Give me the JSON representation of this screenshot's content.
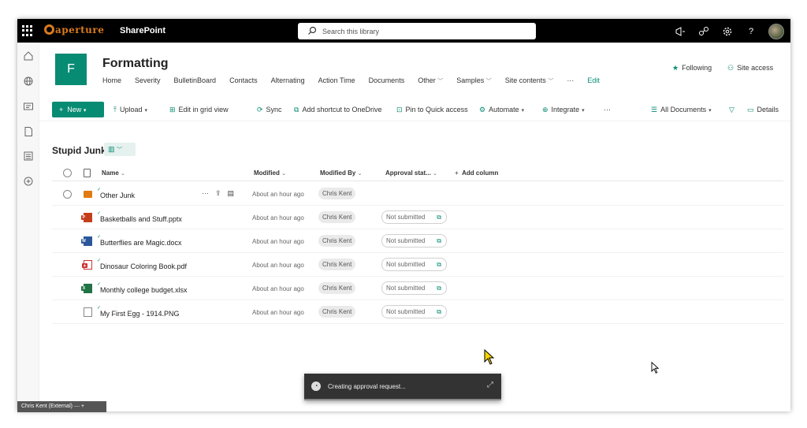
{
  "suitebar": {
    "logo_text": "aperture",
    "app_name": "SharePoint",
    "search_placeholder": "Search this library",
    "icons": [
      "megaphone-icon",
      "network-icon",
      "gear-icon",
      "help-icon"
    ],
    "help_glyph": "?"
  },
  "site": {
    "logo_letter": "F",
    "title": "Formatting",
    "nav": [
      "Home",
      "Severity",
      "BulletinBoard",
      "Contacts",
      "Alternating",
      "Action Time",
      "Documents",
      "Other",
      "Samples",
      "Site contents",
      "···",
      "Edit"
    ],
    "following": "Following",
    "site_access": "Site access"
  },
  "commandbar": {
    "new": "New",
    "upload": "Upload",
    "edit_grid": "Edit in grid view",
    "sync": "Sync",
    "shortcut": "Add shortcut to OneDrive",
    "pin": "Pin to Quick access",
    "automate": "Automate",
    "integrate": "Integrate",
    "more": "···",
    "view": "All Documents",
    "details": "Details"
  },
  "library": {
    "title": "Stupid Junk",
    "columns": {
      "name": "Name",
      "modified": "Modified",
      "modified_by": "Modified By",
      "approval": "Approval stat...",
      "add_column": "Add column"
    },
    "rows": [
      {
        "name": "Other Junk",
        "type": "folder",
        "modified": "About an hour ago",
        "by": "Chris Kent",
        "approval": ""
      },
      {
        "name": "Basketballs and Stuff.pptx",
        "type": "pptx",
        "modified": "About an hour ago",
        "by": "Chris Kent",
        "approval": "Not submitted"
      },
      {
        "name": "Butterflies are Magic.docx",
        "type": "docx",
        "modified": "About an hour ago",
        "by": "Chris Kent",
        "approval": "Not submitted"
      },
      {
        "name": "Dinosaur Coloring Book.pdf",
        "type": "pdf",
        "modified": "About an hour ago",
        "by": "Chris Kent",
        "approval": "Not submitted"
      },
      {
        "name": "Monthly college budget.xlsx",
        "type": "xlsx",
        "modified": "About an hour ago",
        "by": "Chris Kent",
        "approval": "Not submitted"
      },
      {
        "name": "My First Egg - 1914.PNG",
        "type": "png",
        "modified": "About an hour ago",
        "by": "Chris Kent",
        "approval": "Not submitted"
      }
    ]
  },
  "toast": {
    "text": "Creating approval request..."
  },
  "statusbar": {
    "text": "Chris Kent (External)"
  },
  "colors": {
    "accent": "#088b73",
    "suitebar": "#000000",
    "logo": "#d97a1e"
  }
}
